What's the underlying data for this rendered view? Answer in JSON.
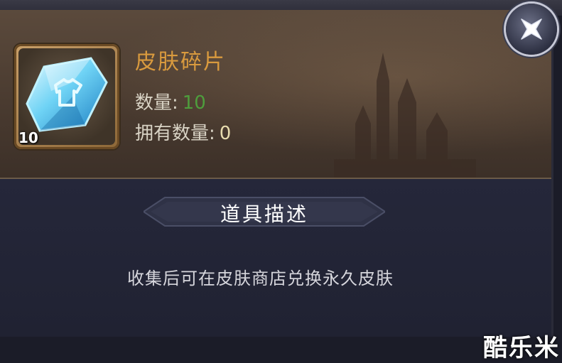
{
  "item": {
    "name": "皮肤碎片",
    "count_badge": "10",
    "quantity_label": "数量:",
    "quantity_value": "10",
    "owned_label": "拥有数量:",
    "owned_value": "0"
  },
  "description": {
    "title": "道具描述",
    "text": "收集后可在皮肤商店兑换永久皮肤"
  },
  "watermark": "酷乐米",
  "icons": {
    "close": "close-icon",
    "item": "skin-fragment-crystal-icon"
  },
  "colors": {
    "item_name": "#d99a3e",
    "quantity_value": "#4e9d3c",
    "owned_value": "#e8dcae"
  }
}
